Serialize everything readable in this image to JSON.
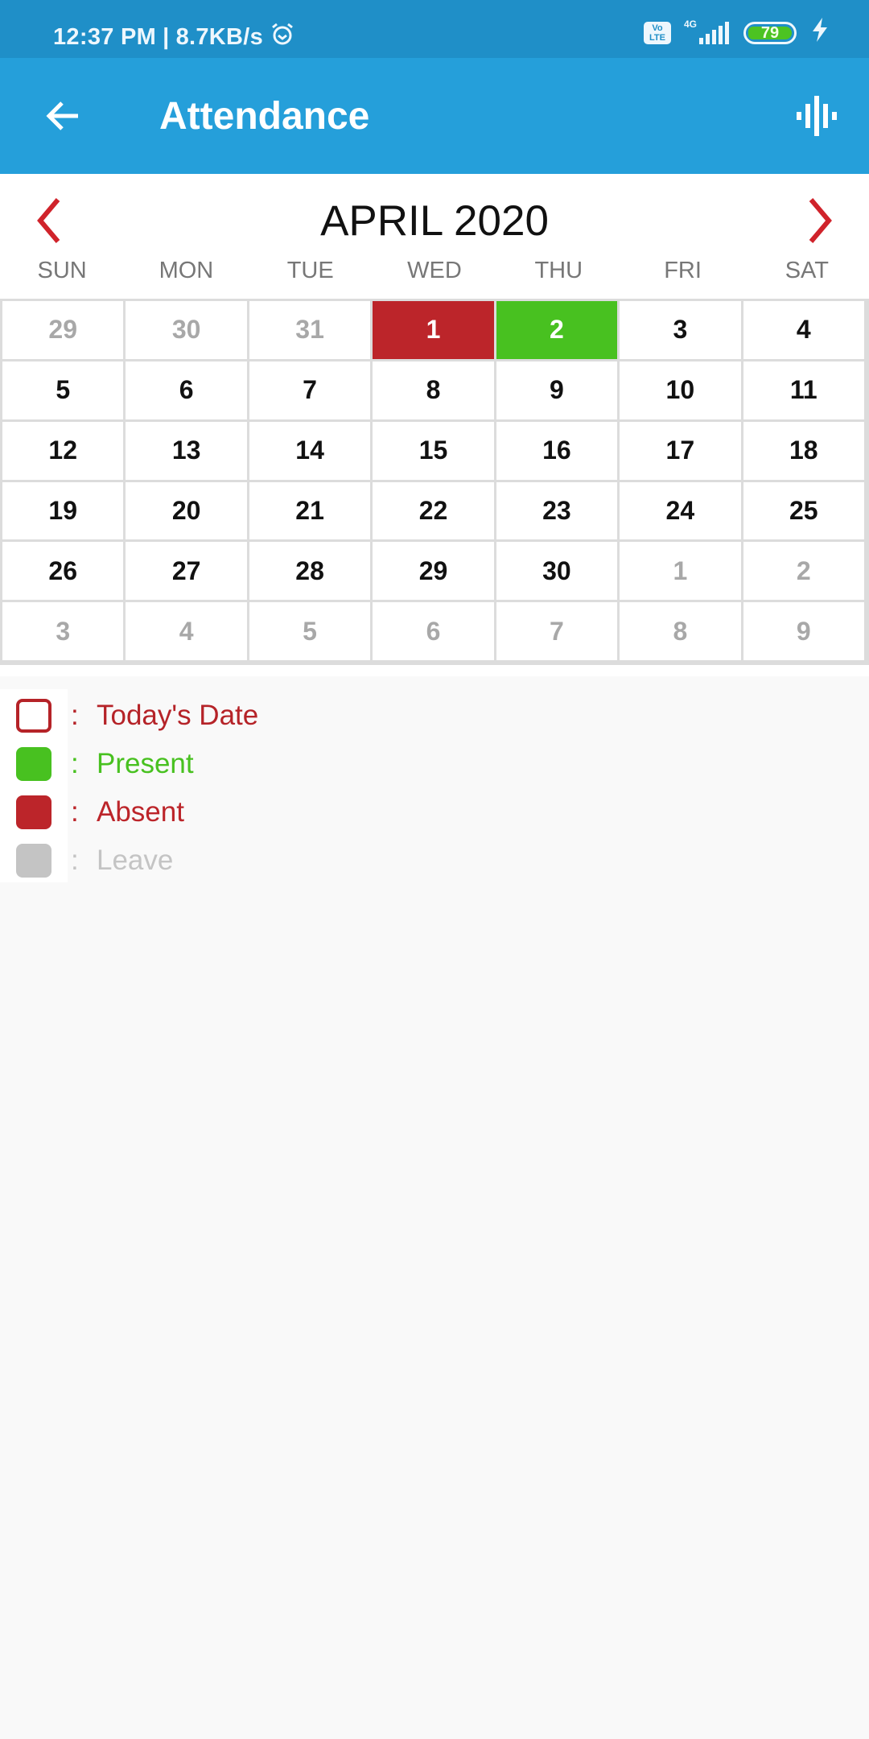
{
  "status_bar": {
    "time": "12:37 PM",
    "separator": "|",
    "net_speed": "8.7KB/s",
    "alarm_icon": "alarm-clock-icon",
    "volte_label_top": "Vo",
    "volte_label_bottom": "LTE",
    "network_type": "4G",
    "signal_icon": "signal-bars-icon",
    "battery_level": "79",
    "charging_icon": "lightning-bolt-icon"
  },
  "app_bar": {
    "title": "Attendance",
    "back_icon": "arrow-left-icon",
    "action_icon": "sound-wave-icon"
  },
  "calendar": {
    "month_label": "APRIL 2020",
    "prev_icon": "chevron-left-icon",
    "next_icon": "chevron-right-icon",
    "weekdays": [
      "SUN",
      "MON",
      "TUE",
      "WED",
      "THU",
      "FRI",
      "SAT"
    ],
    "weeks": [
      [
        {
          "d": "29",
          "s": "other"
        },
        {
          "d": "30",
          "s": "other"
        },
        {
          "d": "31",
          "s": "other"
        },
        {
          "d": "1",
          "s": "absent"
        },
        {
          "d": "2",
          "s": "present"
        },
        {
          "d": "3",
          "s": ""
        },
        {
          "d": "4",
          "s": ""
        }
      ],
      [
        {
          "d": "5",
          "s": ""
        },
        {
          "d": "6",
          "s": ""
        },
        {
          "d": "7",
          "s": ""
        },
        {
          "d": "8",
          "s": ""
        },
        {
          "d": "9",
          "s": ""
        },
        {
          "d": "10",
          "s": ""
        },
        {
          "d": "11",
          "s": ""
        }
      ],
      [
        {
          "d": "12",
          "s": ""
        },
        {
          "d": "13",
          "s": ""
        },
        {
          "d": "14",
          "s": ""
        },
        {
          "d": "15",
          "s": ""
        },
        {
          "d": "16",
          "s": ""
        },
        {
          "d": "17",
          "s": ""
        },
        {
          "d": "18",
          "s": ""
        }
      ],
      [
        {
          "d": "19",
          "s": ""
        },
        {
          "d": "20",
          "s": ""
        },
        {
          "d": "21",
          "s": ""
        },
        {
          "d": "22",
          "s": ""
        },
        {
          "d": "23",
          "s": ""
        },
        {
          "d": "24",
          "s": ""
        },
        {
          "d": "25",
          "s": ""
        }
      ],
      [
        {
          "d": "26",
          "s": ""
        },
        {
          "d": "27",
          "s": ""
        },
        {
          "d": "28",
          "s": ""
        },
        {
          "d": "29",
          "s": ""
        },
        {
          "d": "30",
          "s": ""
        },
        {
          "d": "1",
          "s": "other"
        },
        {
          "d": "2",
          "s": "other"
        }
      ],
      [
        {
          "d": "3",
          "s": "other"
        },
        {
          "d": "4",
          "s": "other"
        },
        {
          "d": "5",
          "s": "other"
        },
        {
          "d": "6",
          "s": "other"
        },
        {
          "d": "7",
          "s": "other"
        },
        {
          "d": "8",
          "s": "other"
        },
        {
          "d": "9",
          "s": "other"
        }
      ]
    ]
  },
  "legend": {
    "separator": ":",
    "items": [
      {
        "label": "Today's Date",
        "color": "#b52328",
        "style": "outline"
      },
      {
        "label": "Present",
        "color": "#48c120",
        "style": "filled"
      },
      {
        "label": "Absent",
        "color": "#bc252a",
        "style": "filled"
      },
      {
        "label": "Leave",
        "color": "#c4c4c4",
        "style": "filled"
      }
    ]
  },
  "colors": {
    "status_bar": "#1f8fc8",
    "app_bar": "#259fda",
    "nav_arrows": "#d0232b",
    "present": "#48c120",
    "absent": "#bc252a",
    "leave": "#c4c4c4",
    "other_month_text": "#a8a8a8"
  }
}
